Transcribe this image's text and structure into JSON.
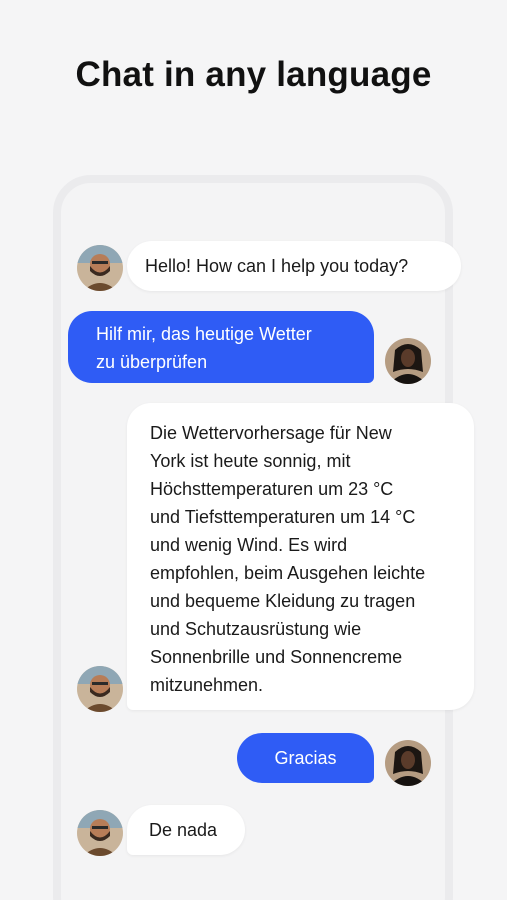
{
  "headline": "Chat in any language",
  "messages": [
    {
      "sender": "bot",
      "text": "Hello! How can I help you today?"
    },
    {
      "sender": "user",
      "text": "Hilf mir, das heutige Wetter\nzu überprüfen"
    },
    {
      "sender": "bot",
      "text": "Die Wettervorhersage für New\nYork ist heute sonnig, mit\nHöchsttemperaturen um 23 °C\nund Tiefsttemperaturen um 14 °C\nund wenig Wind. Es wird\nempfohlen, beim Ausgehen leichte\nund bequeme Kleidung zu tragen\nund Schutzausrüstung wie\nSonnenbrille und Sonnencreme\nmitzunehmen."
    },
    {
      "sender": "user",
      "text": "Gracias"
    },
    {
      "sender": "bot",
      "text": "De nada"
    }
  ],
  "colors": {
    "outgoing_bubble": "#2f5cf5",
    "incoming_bubble": "#ffffff",
    "background": "#f5f5f6"
  },
  "icons": {
    "bot_avatar": "bearded-man-avatar",
    "user_avatar": "woman-portrait-avatar"
  }
}
